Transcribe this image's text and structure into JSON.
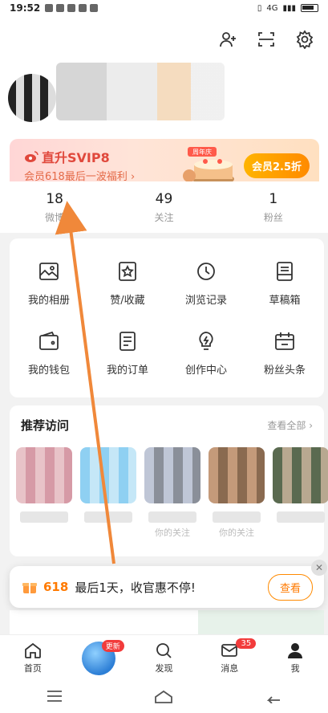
{
  "status_bar": {
    "time": "19:52",
    "network_label": "4G"
  },
  "header": {
    "icons": [
      "add-user-icon",
      "scan-icon",
      "settings-icon"
    ]
  },
  "vip": {
    "title": "直升SVIP8",
    "subtitle": "会员618最后一波福利 ›",
    "ribbon": "周年庆",
    "button": "会员2.5折"
  },
  "stats": [
    {
      "num": "18",
      "label": "微博"
    },
    {
      "num": "49",
      "label": "关注"
    },
    {
      "num": "1",
      "label": "粉丝"
    }
  ],
  "grid": [
    {
      "label": "我的相册",
      "icon": "album-icon"
    },
    {
      "label": "赞/收藏",
      "icon": "favorite-icon"
    },
    {
      "label": "浏览记录",
      "icon": "history-icon"
    },
    {
      "label": "草稿箱",
      "icon": "drafts-icon"
    },
    {
      "label": "我的钱包",
      "icon": "wallet-icon"
    },
    {
      "label": "我的订单",
      "icon": "orders-icon"
    },
    {
      "label": "创作中心",
      "icon": "creator-icon"
    },
    {
      "label": "粉丝头条",
      "icon": "fans-headline-icon"
    }
  ],
  "recommend": {
    "title": "推荐访问",
    "more": "查看全部 ›",
    "items": [
      {
        "reason": ""
      },
      {
        "reason": ""
      },
      {
        "reason": "你的关注"
      },
      {
        "reason": "你的关注"
      },
      {
        "reason": ""
      }
    ]
  },
  "promo": {
    "highlight": "618",
    "text": "最后1天，收官惠不停!",
    "button": "查看"
  },
  "tabbar": [
    {
      "label": "首页",
      "icon": "home-icon"
    },
    {
      "label": "",
      "icon": "globe-icon",
      "badge": "更新"
    },
    {
      "label": "发现",
      "icon": "search-icon"
    },
    {
      "label": "消息",
      "icon": "mail-icon",
      "badge": "35"
    },
    {
      "label": "我",
      "icon": "profile-icon"
    }
  ],
  "colors": {
    "accent": "#ff7a00",
    "vip_red": "#e0483c",
    "badge": "#f23b3b"
  }
}
